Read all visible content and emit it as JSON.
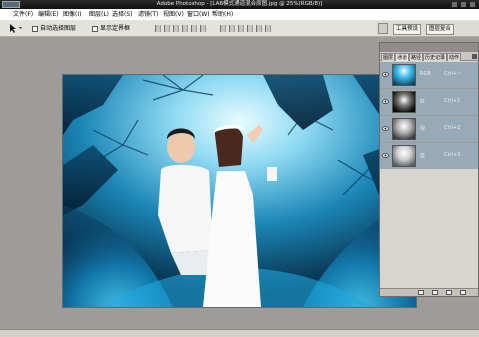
{
  "app": {
    "title": "Adobe Photoshop - [LAB模式通道混合原图.jpg @ 25%(RGB/8)]"
  },
  "menubar": {
    "items": [
      "文件(F)",
      "编辑(E)",
      "图像(I)",
      "图层(L)",
      "选择(S)",
      "滤镜(T)",
      "视图(V)",
      "窗口(W)",
      "帮助(H)"
    ]
  },
  "options": {
    "auto_select_layer": "自动选择图层",
    "show_bounding_box": "显示定界框"
  },
  "panel_well": {
    "tabs": [
      "工具预设",
      "图层复合"
    ]
  },
  "channels_panel": {
    "tabs": [
      "图层",
      "通道",
      "路径",
      "历史记录",
      "动作"
    ],
    "active_tab": "通道",
    "rows": [
      {
        "name": "RGB",
        "shortcut": "Ctrl+~",
        "selected": true
      },
      {
        "name": "红",
        "shortcut": "Ctrl+1",
        "selected": false
      },
      {
        "name": "绿",
        "shortcut": "Ctrl+2",
        "selected": false
      },
      {
        "name": "蓝",
        "shortcut": "Ctrl+3",
        "selected": false
      }
    ]
  },
  "colors": {
    "canvas_blue": "#1aa7e0",
    "selected_row": "#98a9b8"
  },
  "icons": {
    "tool": "move-tool-icon",
    "visibility": "eye-icon"
  }
}
